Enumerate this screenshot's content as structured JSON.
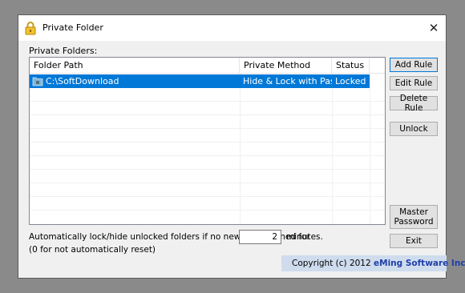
{
  "window": {
    "title": "Private Folder",
    "close_glyph": "✕"
  },
  "list": {
    "caption": "Private Folders:",
    "columns": [
      "Folder Path",
      "Private Method",
      "Status"
    ],
    "rows": [
      {
        "path": "C:\\SoftDownload",
        "method": "Hide & Lock with Password",
        "status": "Locked",
        "icon": "folder-icon"
      }
    ]
  },
  "buttons": {
    "add_rule": "Add Rule",
    "edit_rule": "Edit Rule",
    "delete_rule": "Delete Rule",
    "unlock": "Unlock",
    "master_line1": "Master",
    "master_line2": "Password",
    "exit": "Exit"
  },
  "auto_lock": {
    "text": "Automatically lock/hide unlocked folders if no new file openned for",
    "minutes_value": "2",
    "unit": "minutes.",
    "note": "(0 for not automatically reset)"
  },
  "footer": {
    "copyright": "Copyright (c) 2012",
    "brand": "eMing Software Inc."
  },
  "colors": {
    "selection": "#0078d7",
    "footer_bg": "#cfdcee",
    "brand": "#1f3fa8"
  }
}
